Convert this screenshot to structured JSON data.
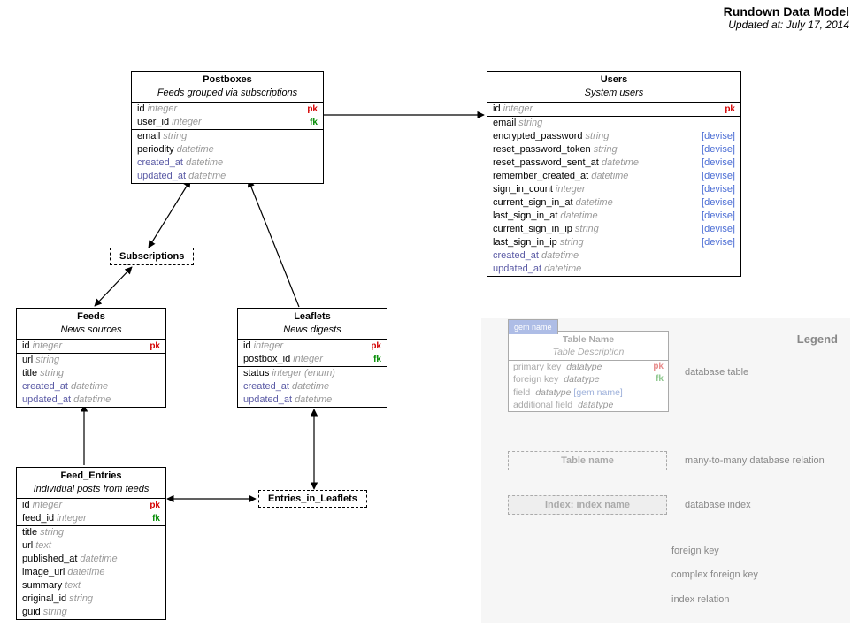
{
  "header": {
    "title": "Rundown Data Model",
    "subtitle": "Updated at: July 17, 2014"
  },
  "tables": {
    "postboxes": {
      "name": "Postboxes",
      "desc": "Feeds grouped via subscriptions",
      "rows_keys": [
        {
          "name": "id",
          "type": "integer",
          "tag": "pk"
        },
        {
          "name": "user_id",
          "type": "integer",
          "tag": "fk"
        }
      ],
      "rows_fields": [
        {
          "name": "email",
          "type": "string"
        },
        {
          "name": "periodity",
          "type": "datetime"
        },
        {
          "name": "created_at",
          "type": "datetime",
          "ts": true
        },
        {
          "name": "updated_at",
          "type": "datetime",
          "ts": true
        }
      ]
    },
    "users": {
      "name": "Users",
      "desc": "System users",
      "rows_keys": [
        {
          "name": "id",
          "type": "integer",
          "tag": "pk"
        }
      ],
      "rows_fields": [
        {
          "name": "email",
          "type": "string"
        },
        {
          "name": "encrypted_password",
          "type": "string",
          "gem": "[devise]"
        },
        {
          "name": "reset_password_token",
          "type": "string",
          "gem": "[devise]"
        },
        {
          "name": "reset_password_sent_at",
          "type": "datetime",
          "gem": "[devise]"
        },
        {
          "name": "remember_created_at",
          "type": "datetime",
          "gem": "[devise]"
        },
        {
          "name": "sign_in_count",
          "type": "integer",
          "gem": "[devise]"
        },
        {
          "name": "current_sign_in_at",
          "type": "datetime",
          "gem": "[devise]"
        },
        {
          "name": "last_sign_in_at",
          "type": "datetime",
          "gem": "[devise]"
        },
        {
          "name": "current_sign_in_ip",
          "type": "string",
          "gem": "[devise]"
        },
        {
          "name": "last_sign_in_ip",
          "type": "string",
          "gem": "[devise]"
        },
        {
          "name": "created_at",
          "type": "datetime",
          "ts": true
        },
        {
          "name": "updated_at",
          "type": "datetime",
          "ts": true
        }
      ]
    },
    "feeds": {
      "name": "Feeds",
      "desc": "News sources",
      "rows_keys": [
        {
          "name": "id",
          "type": "integer",
          "tag": "pk"
        }
      ],
      "rows_fields": [
        {
          "name": "url",
          "type": "string"
        },
        {
          "name": "title",
          "type": "string"
        },
        {
          "name": "created_at",
          "type": "datetime",
          "ts": true
        },
        {
          "name": "updated_at",
          "type": "datetime",
          "ts": true
        }
      ]
    },
    "leaflets": {
      "name": "Leaflets",
      "desc": "News digests",
      "rows_keys": [
        {
          "name": "id",
          "type": "integer",
          "tag": "pk"
        },
        {
          "name": "postbox_id",
          "type": "integer",
          "tag": "fk"
        }
      ],
      "rows_fields": [
        {
          "name": "status",
          "type": "integer (enum)"
        },
        {
          "name": "created_at",
          "type": "datetime",
          "ts": true
        },
        {
          "name": "updated_at",
          "type": "datetime",
          "ts": true
        }
      ]
    },
    "feed_entries": {
      "name": "Feed_Entries",
      "desc": "Individual posts from feeds",
      "rows_keys": [
        {
          "name": "id",
          "type": "integer",
          "tag": "pk"
        },
        {
          "name": "feed_id",
          "type": "integer",
          "tag": "fk"
        }
      ],
      "rows_fields": [
        {
          "name": "title",
          "type": "string"
        },
        {
          "name": "url",
          "type": "text"
        },
        {
          "name": "published_at",
          "type": "datetime"
        },
        {
          "name": "image_url",
          "type": "datetime"
        },
        {
          "name": "summary",
          "type": "text"
        },
        {
          "name": "original_id",
          "type": "string"
        },
        {
          "name": "guid",
          "type": "string"
        }
      ]
    }
  },
  "relations": {
    "subscriptions": "Subscriptions",
    "entries_in_leaflets": "Entries_in_Leaflets"
  },
  "legend": {
    "title": "Legend",
    "gem_tab": "gem name",
    "table_name": "Table Name",
    "table_desc": "Table Description",
    "rows": [
      {
        "name": "primary key",
        "type": "datatype",
        "tag": "pk"
      },
      {
        "name": "foreign key",
        "type": "datatype",
        "tag": "fk"
      },
      {
        "name": "field",
        "type": "datatype",
        "gem": "[gem name]"
      },
      {
        "name": "additional field",
        "type": "datatype"
      }
    ],
    "labels": {
      "db_table": "database table",
      "m2m": "many-to-many database relation",
      "db_index": "database index",
      "fk_arrow": "foreign key",
      "cfk_arrow": "complex foreign key",
      "idx_arrow": "index relation"
    },
    "rel_box": "Table name",
    "idx_box": "Index: index name"
  }
}
